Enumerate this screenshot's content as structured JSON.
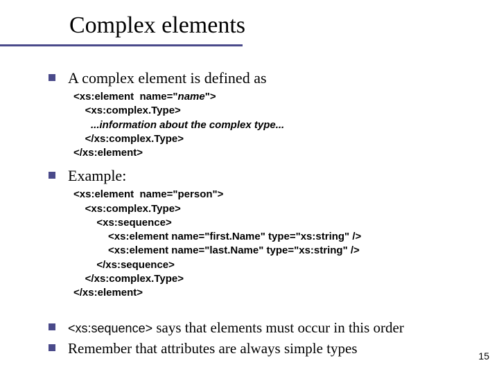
{
  "title": "Complex elements",
  "bullets": {
    "b1": "A complex element is defined as",
    "b2": "Example:",
    "b3_pre": "<xs:sequence>",
    "b3_post": " says that elements must occur in this order",
    "b4": "Remember that attributes are always simple types"
  },
  "code1": {
    "l1a": "<xs:element  name=\"",
    "l1b": "name",
    "l1c": "\">",
    "l2": "    <xs:complex.Type>",
    "l3": "      ...information about the complex type...",
    "l4": "    </xs:complex.Type>",
    "l5": "</xs:element>"
  },
  "code2": {
    "l1": "<xs:element  name=\"person\">",
    "l2": "    <xs:complex.Type>",
    "l3": "        <xs:sequence>",
    "l4": "            <xs:element name=\"first.Name\" type=\"xs:string\" />",
    "l5": "            <xs:element name=\"last.Name\" type=\"xs:string\" />",
    "l6": "        </xs:sequence>",
    "l7": "    </xs:complex.Type>",
    "l8": "</xs:element>"
  },
  "pagenum": "15"
}
